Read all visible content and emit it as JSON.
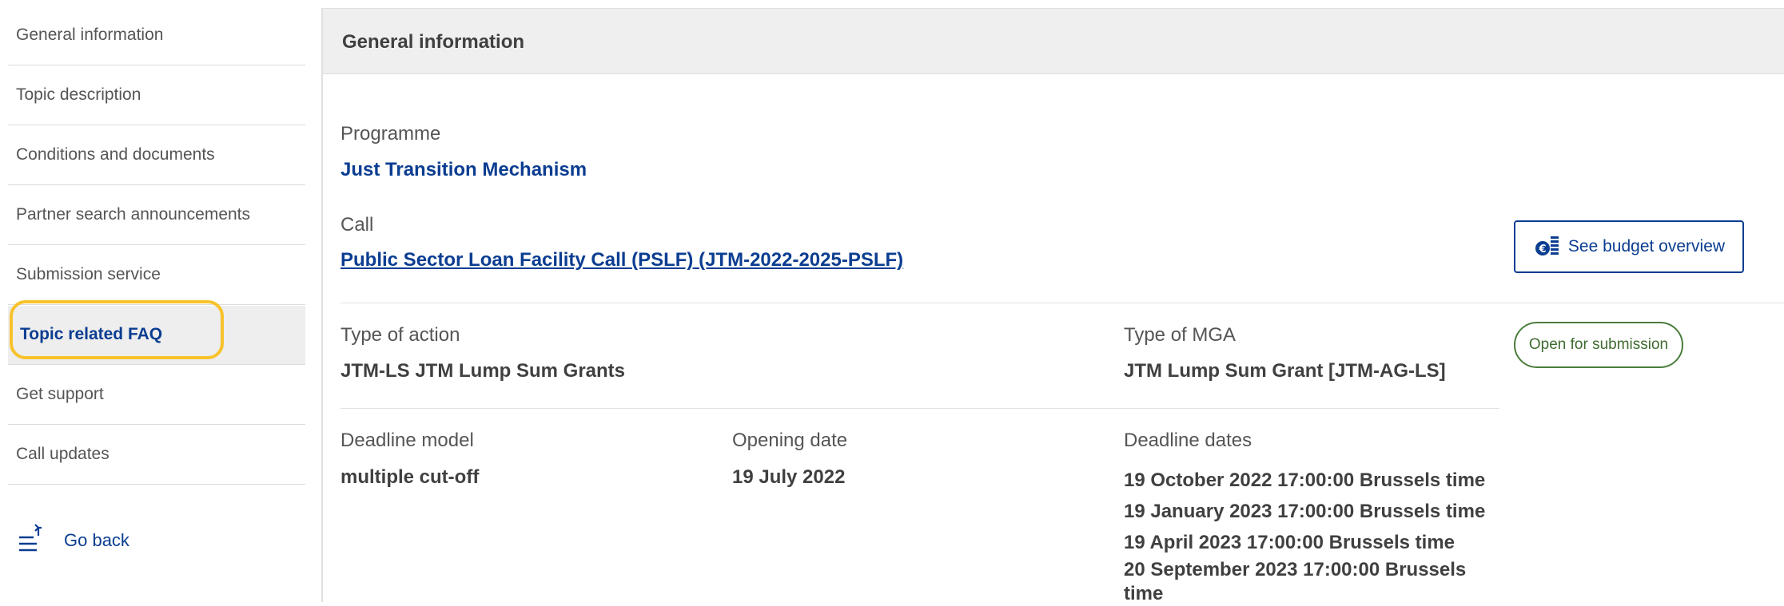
{
  "sidebar": {
    "items": [
      {
        "label": "General information"
      },
      {
        "label": "Topic description"
      },
      {
        "label": "Conditions and documents"
      },
      {
        "label": "Partner search announcements"
      },
      {
        "label": "Submission service"
      },
      {
        "label": "Topic related FAQ"
      },
      {
        "label": "Get support"
      },
      {
        "label": "Call updates"
      }
    ],
    "go_back": {
      "label": "Go back",
      "icon": "list-back-icon"
    }
  },
  "main": {
    "header_title": "General information",
    "programme": {
      "label": "Programme",
      "value": "Just Transition Mechanism"
    },
    "call": {
      "label": "Call",
      "value": "Public Sector Loan Facility Call (PSLF) (JTM-2022-2025-PSLF)"
    },
    "budget_button": {
      "label": "See budget overview",
      "icon": "euro-coins-icon"
    },
    "type_of_action": {
      "label": "Type of action",
      "value": "JTM-LS JTM Lump Sum Grants"
    },
    "type_of_mga": {
      "label": "Type of MGA",
      "value": "JTM Lump Sum Grant [JTM-AG-LS]"
    },
    "status": "Open for submission",
    "deadline_model": {
      "label": "Deadline model",
      "value": "multiple cut-off"
    },
    "opening_date": {
      "label": "Opening date",
      "value": "19 July 2022"
    },
    "deadline_dates": {
      "label": "Deadline dates",
      "values": [
        "19 October 2022 17:00:00 Brussels time",
        "19 January 2023 17:00:00 Brussels time",
        "19 April 2023 17:00:00 Brussels time",
        "20 September 2023 17:00:00 Brussels time"
      ]
    }
  },
  "colors": {
    "link_blue": "#0b3d91",
    "highlight_yellow": "#f7c22b",
    "status_green": "#4a7c3a",
    "header_gray": "#efefef"
  }
}
